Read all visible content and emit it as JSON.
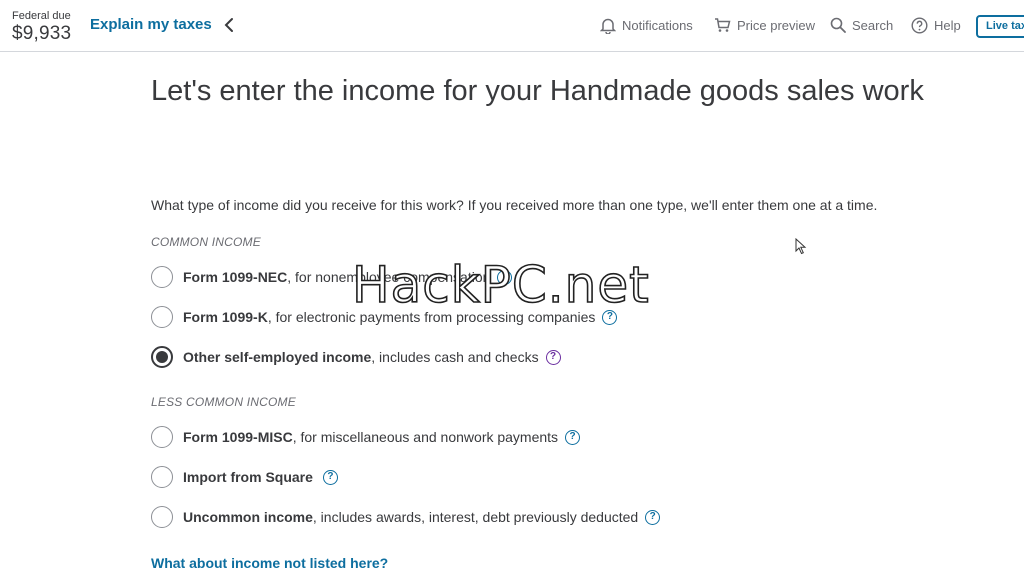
{
  "header": {
    "federal_label": "Federal due",
    "federal_amount": "$9,933",
    "explain_link": "Explain my taxes",
    "nav": {
      "notifications": "Notifications",
      "price_preview": "Price preview",
      "search": "Search",
      "help": "Help"
    },
    "live_button": "Live tax"
  },
  "main": {
    "title": "Let's enter the income for your Handmade goods sales work",
    "question": "What type of income did you receive for this work? If you received more than one type, we'll enter them one at a time.",
    "common_section": "COMMON INCOME",
    "less_common_section": "LESS COMMON INCOME",
    "options": [
      {
        "bold": "Form 1099-NEC",
        "rest": ", for nonemployee compensation",
        "selected": false
      },
      {
        "bold": "Form 1099-K",
        "rest": ", for electronic payments from processing companies",
        "selected": false
      },
      {
        "bold": "Other self-employed income",
        "rest": ", includes cash and checks",
        "selected": true
      },
      {
        "bold": "Form 1099-MISC",
        "rest": ", for miscellaneous and nonwork payments",
        "selected": false
      },
      {
        "bold": "Import from Square",
        "rest": "",
        "selected": false
      },
      {
        "bold": "Uncommon income",
        "rest": ", includes awards, interest, debt previously deducted",
        "selected": false
      }
    ],
    "info_glyph": "?",
    "not_listed_link": "What about income not listed here?"
  },
  "watermark": "HackPC.net",
  "colors": {
    "link": "#0d6e9f",
    "text": "#393a3d",
    "muted": "#6b6c72",
    "selected_info": "#6b2fa0"
  }
}
